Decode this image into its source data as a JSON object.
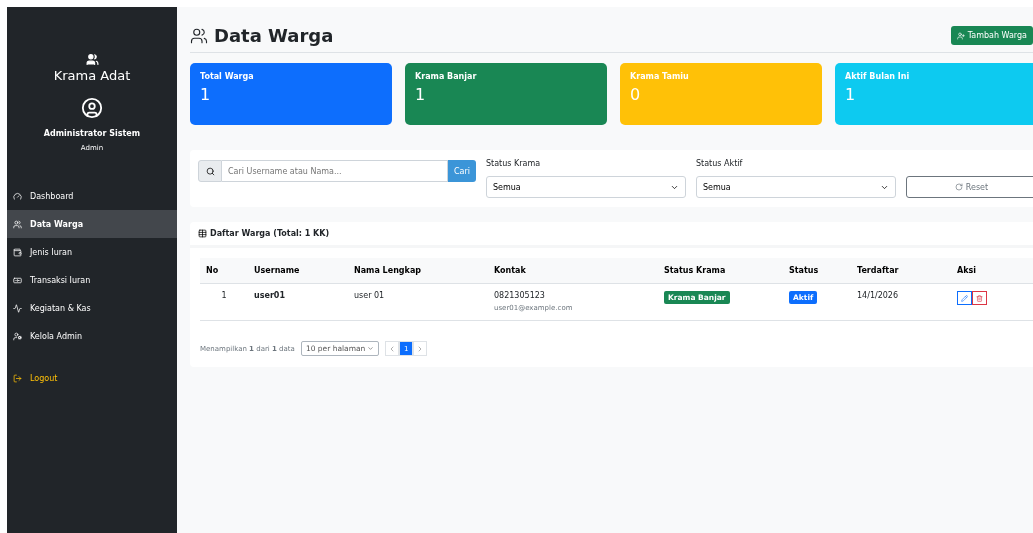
{
  "sidebar": {
    "brand": "Krama Adat",
    "user_name": "Administrator Sistem",
    "user_role": "Admin",
    "items": [
      {
        "label": "Dashboard",
        "selected": false,
        "kind": "link"
      },
      {
        "label": "Data Warga",
        "selected": true,
        "kind": "link"
      },
      {
        "label": "Jenis Iuran",
        "selected": false,
        "kind": "link"
      },
      {
        "label": "Transaksi Iuran",
        "selected": false,
        "kind": "link"
      },
      {
        "label": "Kegiatan & Kas",
        "selected": false,
        "kind": "link"
      },
      {
        "label": "Kelola Admin",
        "selected": false,
        "kind": "link"
      },
      {
        "label": "Logout",
        "selected": false,
        "kind": "logout"
      }
    ]
  },
  "page": {
    "title": "Data Warga",
    "add_button": "Tambah Warga"
  },
  "stats": [
    {
      "label": "Total Warga",
      "value": "1",
      "color": "#0d6efd"
    },
    {
      "label": "Krama Banjar",
      "value": "1",
      "color": "#198754"
    },
    {
      "label": "Krama Tamiu",
      "value": "0",
      "color": "#ffc107"
    },
    {
      "label": "Aktif Bulan Ini",
      "value": "1",
      "color": "#0dcaf0"
    }
  ],
  "filters": {
    "search_placeholder": "Cari Username atau Nama...",
    "search_button": "Cari",
    "status_krama_label": "Status Krama",
    "status_krama_value": "Semua",
    "status_aktif_label": "Status Aktif",
    "status_aktif_value": "Semua",
    "reset_button": "Reset"
  },
  "table": {
    "title": "Daftar Warga (Total: 1 KK)",
    "columns": [
      "No",
      "Username",
      "Nama Lengkap",
      "Kontak",
      "Status Krama",
      "Status",
      "Terdaftar",
      "Aksi"
    ],
    "rows": [
      {
        "no": "1",
        "username": "user01",
        "name": "user 01",
        "phone": "0821305123",
        "email": "user01@example.com",
        "krama": {
          "label": "Krama Banjar",
          "color": "#198754"
        },
        "status": {
          "label": "Aktif",
          "color": "#0d6efd"
        },
        "registered": "14/1/2026"
      }
    ]
  },
  "pagination": {
    "summary": "Menampilkan **1** dari **1** data",
    "page_size": "10 per halaman",
    "pages": [
      {
        "label": "1",
        "selected": true
      }
    ]
  }
}
